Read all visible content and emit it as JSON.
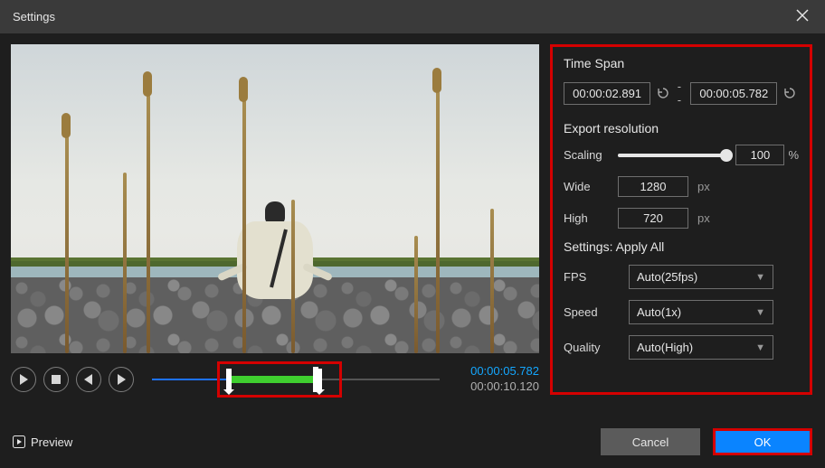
{
  "titlebar": {
    "title": "Settings"
  },
  "transport": {
    "current_time": "00:00:05.782",
    "total_time": "00:00:10.120"
  },
  "right_panel": {
    "time_span_label": "Time Span",
    "time_start": "00:00:02.891",
    "time_end": "00:00:05.782",
    "separator": "--",
    "export_res_label": "Export resolution",
    "scaling_label": "Scaling",
    "scaling_value": "100",
    "scaling_unit": "%",
    "wide_label": "Wide",
    "wide_value": "1280",
    "high_label": "High",
    "high_value": "720",
    "px_unit": "px",
    "apply_all_label": "Settings: Apply All",
    "fps_label": "FPS",
    "fps_value": "Auto(25fps)",
    "speed_label": "Speed",
    "speed_value": "Auto(1x)",
    "quality_label": "Quality",
    "quality_value": "Auto(High)"
  },
  "footer": {
    "preview_label": "Preview",
    "cancel_label": "Cancel",
    "ok_label": "OK"
  }
}
